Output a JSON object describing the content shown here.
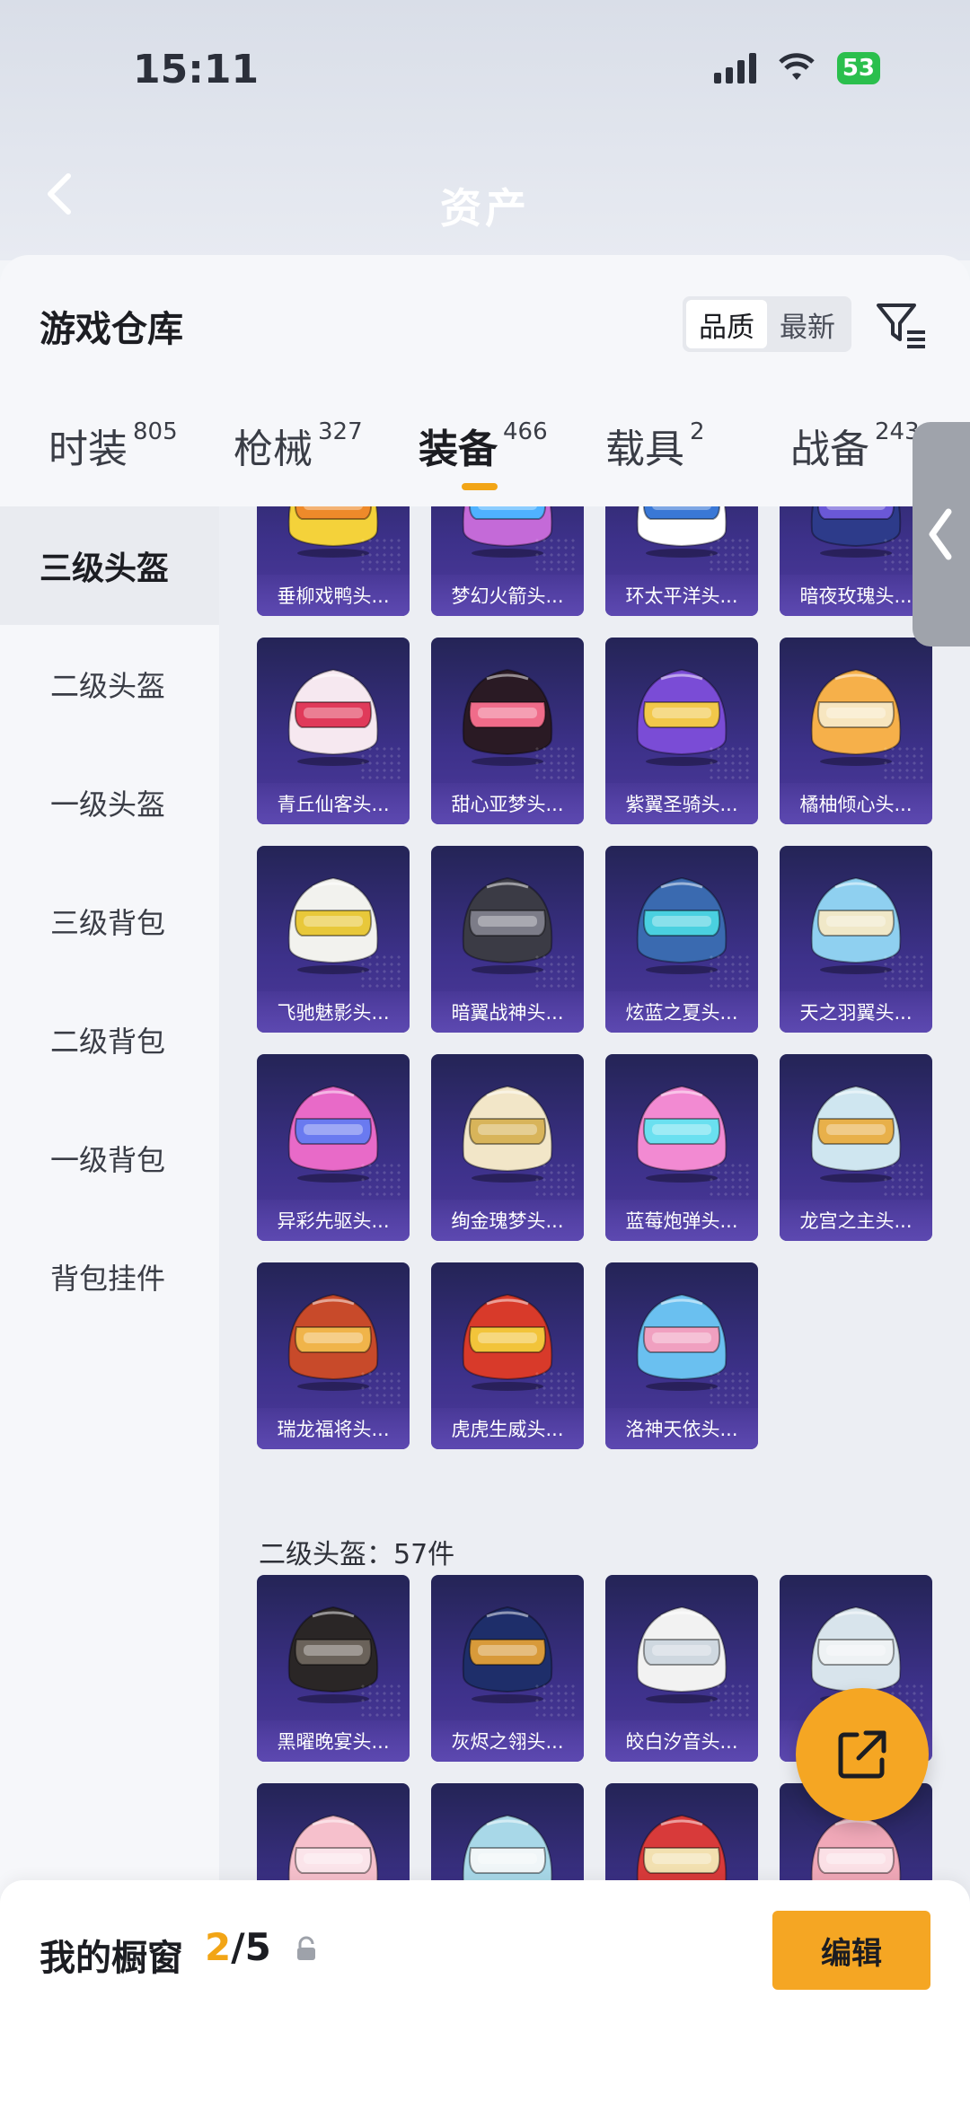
{
  "status_bar": {
    "time": "15:11",
    "battery": "53"
  },
  "header": {
    "title": "资产"
  },
  "sheet": {
    "title": "游戏仓库",
    "sort_options": [
      "品质",
      "最新"
    ],
    "sort_active": "品质"
  },
  "tabs": [
    {
      "label": "时装",
      "count": "805"
    },
    {
      "label": "枪械",
      "count": "327"
    },
    {
      "label": "装备",
      "count": "466",
      "active": true
    },
    {
      "label": "载具",
      "count": "2"
    },
    {
      "label": "战备",
      "count": "243"
    }
  ],
  "categories": [
    "三级头盔",
    "二级头盔",
    "一级头盔",
    "三级背包",
    "二级背包",
    "一级背包",
    "背包挂件"
  ],
  "active_category": "三级头盔",
  "items_level3": [
    {
      "name": "垂柳戏鸭头...",
      "colors": [
        "#f4d23a",
        "#ee8a2a"
      ]
    },
    {
      "name": "梦幻火箭头...",
      "colors": [
        "#c46ad8",
        "#4fb2ff"
      ]
    },
    {
      "name": "环太平洋头...",
      "colors": [
        "#ffffff",
        "#3a78d6"
      ]
    },
    {
      "name": "暗夜玫瑰头...",
      "colors": [
        "#2d3b8a",
        "#6a58d6"
      ]
    },
    {
      "name": "青丘仙客头...",
      "colors": [
        "#f6e8f0",
        "#e03a5a"
      ]
    },
    {
      "name": "甜心亚梦头...",
      "colors": [
        "#2a1a24",
        "#f06c8a"
      ]
    },
    {
      "name": "紫翼圣骑头...",
      "colors": [
        "#7a4cd6",
        "#f2c84a"
      ]
    },
    {
      "name": "橘柚倾心头...",
      "colors": [
        "#f6b04a",
        "#f7e6c0"
      ]
    },
    {
      "name": "飞驰魅影头...",
      "colors": [
        "#f2f2ee",
        "#e8c83a"
      ]
    },
    {
      "name": "暗翼战神头...",
      "colors": [
        "#3b3b45",
        "#7c7c88"
      ]
    },
    {
      "name": "炫蓝之夏头...",
      "colors": [
        "#3a6ab0",
        "#4ad0e0"
      ]
    },
    {
      "name": "天之羽翼头...",
      "colors": [
        "#8fd0f0",
        "#f0e8c8"
      ]
    },
    {
      "name": "异彩先驱头...",
      "colors": [
        "#e86ac8",
        "#6a7af0"
      ]
    },
    {
      "name": "绚金瑰梦头...",
      "colors": [
        "#f2e6c8",
        "#d8b45a"
      ]
    },
    {
      "name": "蓝莓炮弹头...",
      "colors": [
        "#f28ad2",
        "#6ae0f0"
      ]
    },
    {
      "name": "龙宫之主头...",
      "colors": [
        "#cfe6f0",
        "#e8b04a"
      ]
    },
    {
      "name": "瑞龙福将头...",
      "colors": [
        "#c84a2a",
        "#f0b44a"
      ]
    },
    {
      "name": "虎虎生威头...",
      "colors": [
        "#d83a2a",
        "#f2c43a"
      ]
    },
    {
      "name": "洛神天依头...",
      "colors": [
        "#6ac0f0",
        "#f0a0c0"
      ]
    }
  ],
  "section_level2": "二级头盔：57件",
  "items_level2": [
    {
      "name": "黑曜晚宴头...",
      "colors": [
        "#2a2626",
        "#6a625a"
      ]
    },
    {
      "name": "灰烬之翎头...",
      "colors": [
        "#1e2e6a",
        "#d89a3a"
      ]
    },
    {
      "name": "皎白汐音头...",
      "colors": [
        "#f2f2f2",
        "#cfd8e0"
      ]
    },
    {
      "name": "",
      "colors": [
        "#d8e4ec",
        "#eef2f4"
      ]
    },
    {
      "name": "",
      "colors": [
        "#f6c0cc",
        "#fbe4ea"
      ]
    },
    {
      "name": "",
      "colors": [
        "#a8d8e8",
        "#f0f6f8"
      ]
    },
    {
      "name": "",
      "colors": [
        "#d83a3a",
        "#f2e0b0"
      ]
    },
    {
      "name": "",
      "colors": [
        "#f0a8b8",
        "#fbe0e6"
      ]
    }
  ],
  "bottom": {
    "label": "我的橱窗",
    "current": "2",
    "total": "/5",
    "edit": "编辑"
  }
}
